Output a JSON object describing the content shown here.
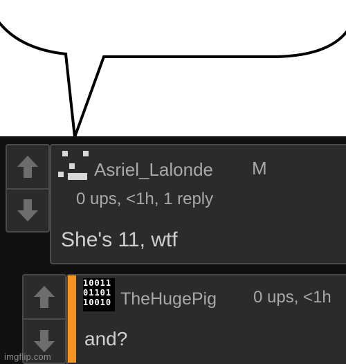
{
  "comment1": {
    "username": "Asriel_Lalonde",
    "badge": "M",
    "meta": "0 ups, <1h, 1 reply",
    "body": "She's 11, wtf"
  },
  "comment2": {
    "username": "TheHugePig",
    "meta": "0 ups, <1h",
    "body": "and?",
    "avatar_text": "10011\n01101\n10010"
  },
  "watermark": "imgflip.com",
  "icons": {
    "upvote": "arrow-up-icon",
    "downvote": "arrow-down-icon"
  },
  "colors": {
    "reply_accent": "#f7941d",
    "panel_bg": "#2b2b2b",
    "page_bg": "#111111"
  }
}
